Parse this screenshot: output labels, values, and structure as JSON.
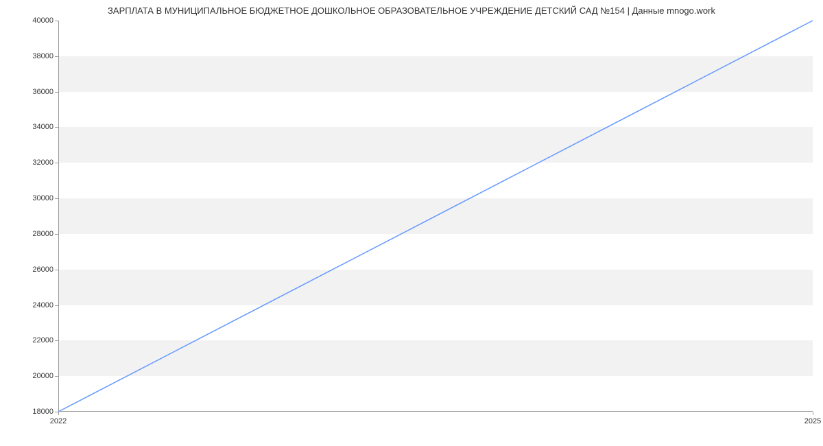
{
  "chart_data": {
    "type": "line",
    "title": "ЗАРПЛАТА В МУНИЦИПАЛЬНОЕ БЮДЖЕТНОЕ ДОШКОЛЬНОЕ ОБРАЗОВАТЕЛЬНОЕ УЧРЕЖДЕНИЕ ДЕТСКИЙ САД №154 | Данные mnogo.work",
    "x": [
      2022,
      2025
    ],
    "values": [
      18000,
      40000
    ],
    "xlabel": "",
    "ylabel": "",
    "xlim": [
      2022,
      2025
    ],
    "ylim": [
      18000,
      40000
    ],
    "x_ticks": [
      2022,
      2025
    ],
    "y_ticks": [
      18000,
      20000,
      22000,
      24000,
      26000,
      28000,
      30000,
      32000,
      34000,
      36000,
      38000,
      40000
    ],
    "line_color": "#6699ff",
    "band_color": "#f2f2f2"
  }
}
